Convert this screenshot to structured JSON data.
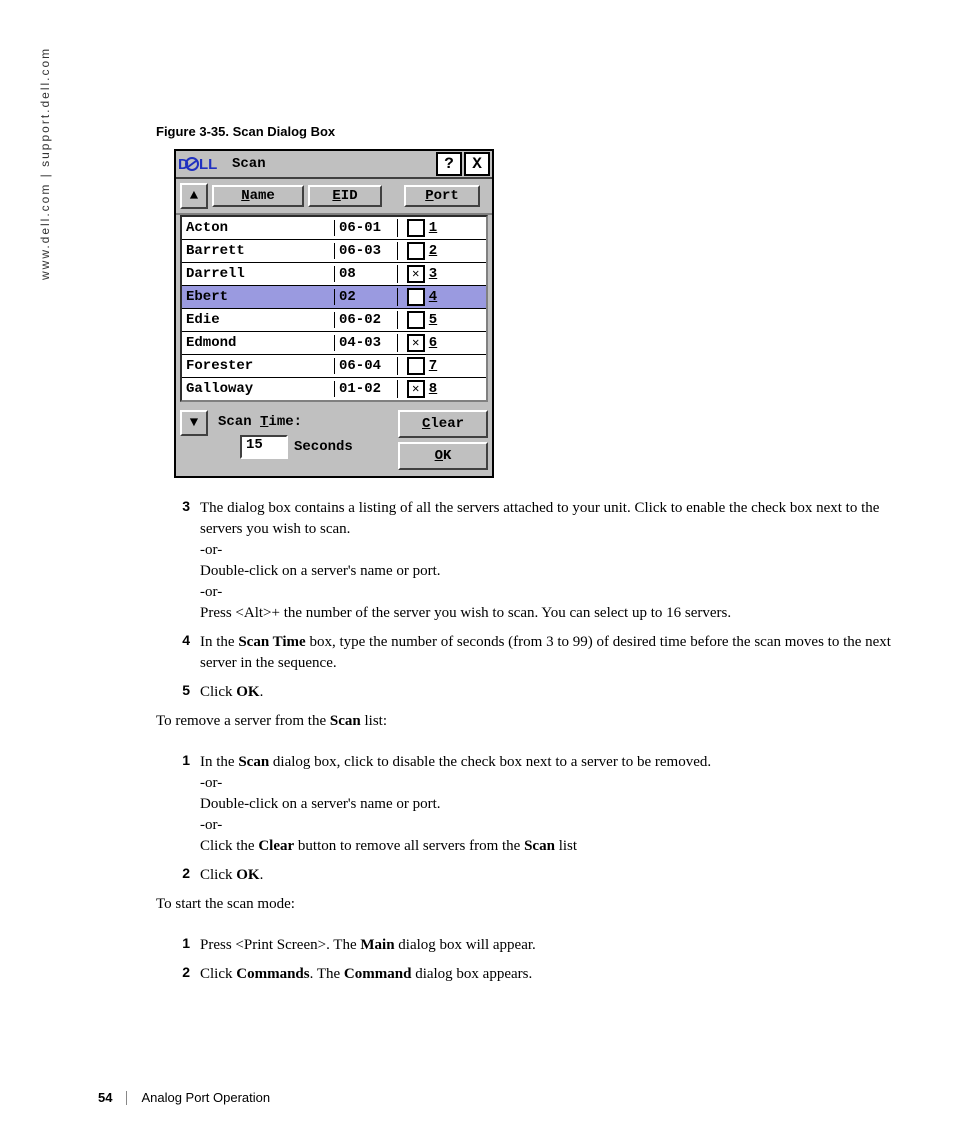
{
  "side_url": "www.dell.com | support.dell.com",
  "figure_caption": "Figure 3-35.    Scan Dialog Box",
  "dialog": {
    "title": "Scan",
    "help": "?",
    "close": "X",
    "sort_up": "▲",
    "sort_down": "▼",
    "col_name_pre": "",
    "col_name_u": "N",
    "col_name_post": "ame",
    "col_eid_pre": "",
    "col_eid_u": "E",
    "col_eid_post": "ID",
    "col_port_pre": "",
    "col_port_u": "P",
    "col_port_post": "ort",
    "rows": [
      {
        "name": "Acton",
        "port": "06-01",
        "checked": false,
        "num": "1",
        "sel": false
      },
      {
        "name": "Barrett",
        "port": "06-03",
        "checked": false,
        "num": "2",
        "sel": false
      },
      {
        "name": "Darrell",
        "port": "08",
        "checked": true,
        "num": "3",
        "sel": false
      },
      {
        "name": "Ebert",
        "port": "02",
        "checked": false,
        "num": "4",
        "sel": true
      },
      {
        "name": "Edie",
        "port": "06-02",
        "checked": false,
        "num": "5",
        "sel": false
      },
      {
        "name": "Edmond",
        "port": "04-03",
        "checked": true,
        "num": "6",
        "sel": false
      },
      {
        "name": "Forester",
        "port": "06-04",
        "checked": false,
        "num": "7",
        "sel": false
      },
      {
        "name": "Galloway",
        "port": "01-02",
        "checked": true,
        "num": "8",
        "sel": false
      }
    ],
    "scan_label_pre": "Scan ",
    "scan_label_u": "T",
    "scan_label_post": "ime:",
    "scan_value": "15",
    "scan_unit": "Seconds",
    "clear_u": "C",
    "clear_post": "lear",
    "ok_u": "O",
    "ok_post": "K"
  },
  "steps_a": [
    {
      "n": "3",
      "html": "The dialog box contains a listing of all the servers attached to your unit. Click to enable the check box next to the servers you wish to scan.<br>-or-<br>Double-click on a server's name or port.<br>-or-<br>Press &lt;Alt&gt;+ the number of the server you wish to scan. You can select up to 16 servers."
    },
    {
      "n": "4",
      "html": "In the <b class='doc'>Scan Time</b> box, type the number of seconds (from 3 to 99) of desired time before the scan moves to the next server in the sequence."
    },
    {
      "n": "5",
      "html": "Click <b class='doc'>OK</b>."
    }
  ],
  "para_remove": "To remove a server from the <b class='doc'>Scan</b> list:",
  "steps_b": [
    {
      "n": "1",
      "html": "In the <b class='doc'>Scan</b> dialog box, click to disable the check box next to a server to be removed.<br>-or-<br>Double-click on a server's name or port.<br>-or-<br>Click the <b class='doc'>Clear</b> button to remove all servers from the <b class='doc'>Scan</b> list"
    },
    {
      "n": "2",
      "html": "Click <b class='doc'>OK</b>."
    }
  ],
  "para_start": "To start the scan mode:",
  "steps_c": [
    {
      "n": "1",
      "html": "Press &lt;Print Screen&gt;. The <b class='doc'>Main</b> dialog box will appear."
    },
    {
      "n": "2",
      "html": "Click <b class='doc'>Commands</b>. The <b class='doc'>Command</b> dialog box appears."
    }
  ],
  "footer": {
    "page": "54",
    "section": "Analog Port Operation"
  }
}
